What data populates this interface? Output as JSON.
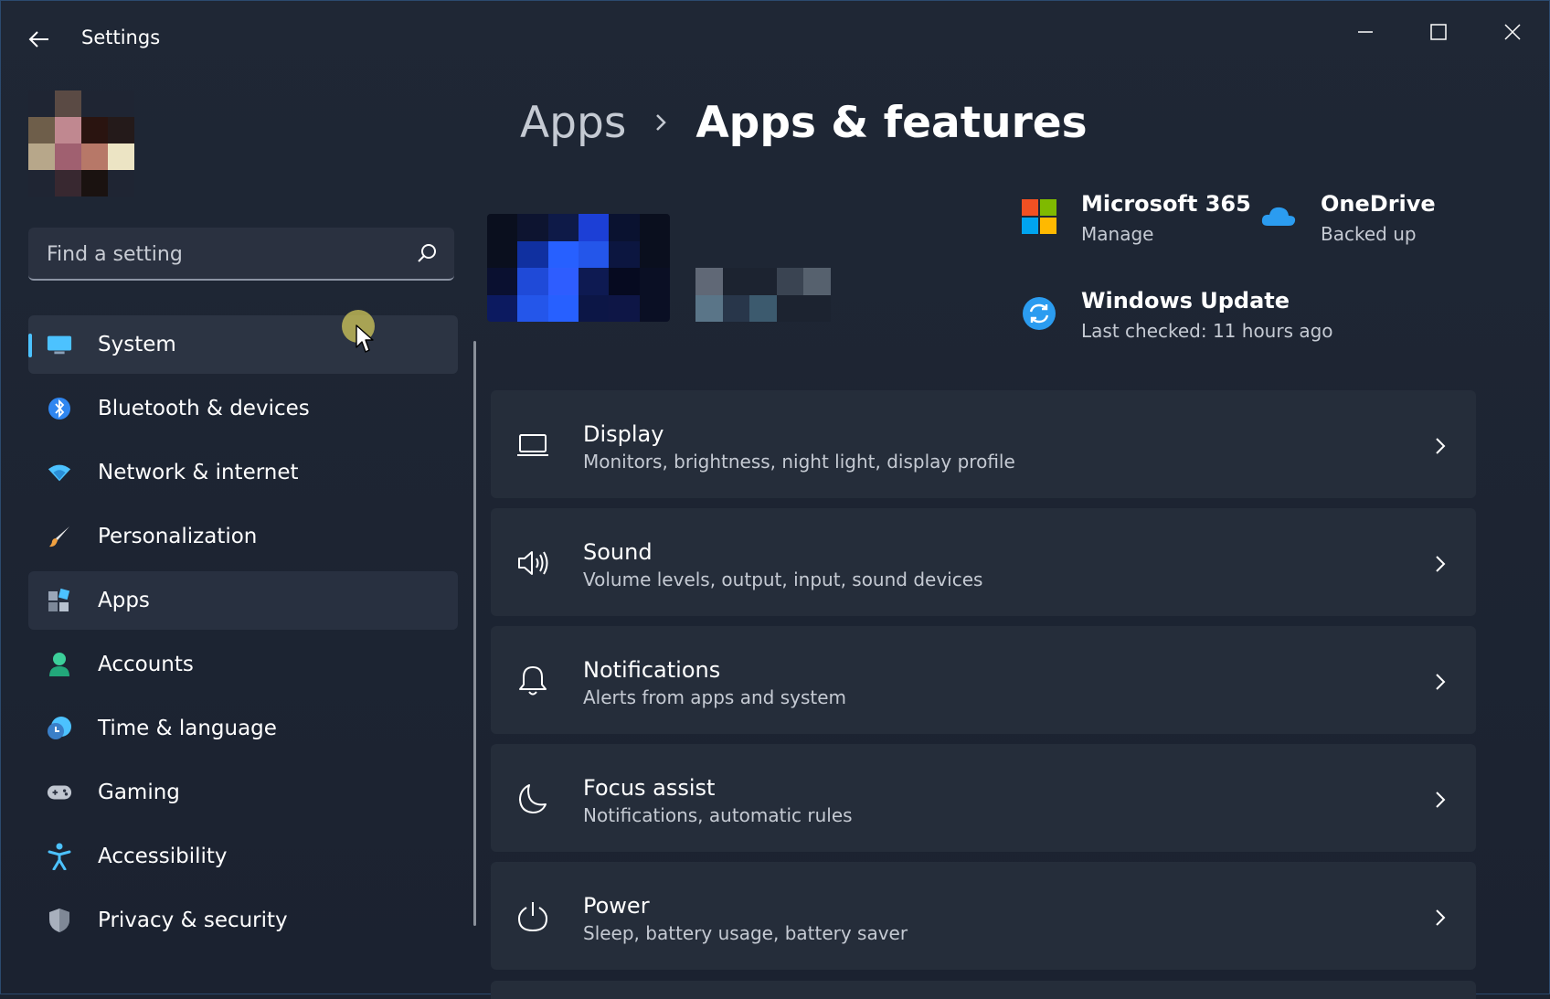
{
  "window": {
    "title": "Settings"
  },
  "search": {
    "placeholder": "Find a setting"
  },
  "nav": {
    "items": [
      {
        "label": "System",
        "icon": "monitor-icon"
      },
      {
        "label": "Bluetooth & devices",
        "icon": "bluetooth-icon"
      },
      {
        "label": "Network & internet",
        "icon": "wifi-icon"
      },
      {
        "label": "Personalization",
        "icon": "brush-icon"
      },
      {
        "label": "Apps",
        "icon": "apps-icon"
      },
      {
        "label": "Accounts",
        "icon": "person-icon"
      },
      {
        "label": "Time & language",
        "icon": "clock-globe-icon"
      },
      {
        "label": "Gaming",
        "icon": "controller-icon"
      },
      {
        "label": "Accessibility",
        "icon": "accessibility-icon"
      },
      {
        "label": "Privacy & security",
        "icon": "shield-icon"
      }
    ]
  },
  "breadcrumb": {
    "parent": "Apps",
    "current": "Apps & features"
  },
  "quick_links": {
    "m365": {
      "title": "Microsoft 365",
      "sub": "Manage"
    },
    "onedrive": {
      "title": "OneDrive",
      "sub": "Backed up"
    },
    "update": {
      "title": "Windows Update",
      "sub": "Last checked: 11 hours ago"
    }
  },
  "cards": [
    {
      "title": "Display",
      "sub": "Monitors, brightness, night light, display profile",
      "icon": "laptop-icon"
    },
    {
      "title": "Sound",
      "sub": "Volume levels, output, input, sound devices",
      "icon": "speaker-icon"
    },
    {
      "title": "Notifications",
      "sub": "Alerts from apps and system",
      "icon": "bell-icon"
    },
    {
      "title": "Focus assist",
      "sub": "Notifications, automatic rules",
      "icon": "moon-icon"
    },
    {
      "title": "Power",
      "sub": "Sleep, battery usage, battery saver",
      "icon": "power-icon"
    }
  ],
  "colors": {
    "accent": "#4cc2ff",
    "background": "#1c2330",
    "card": "#252d3a",
    "selected": "#2c3443"
  }
}
